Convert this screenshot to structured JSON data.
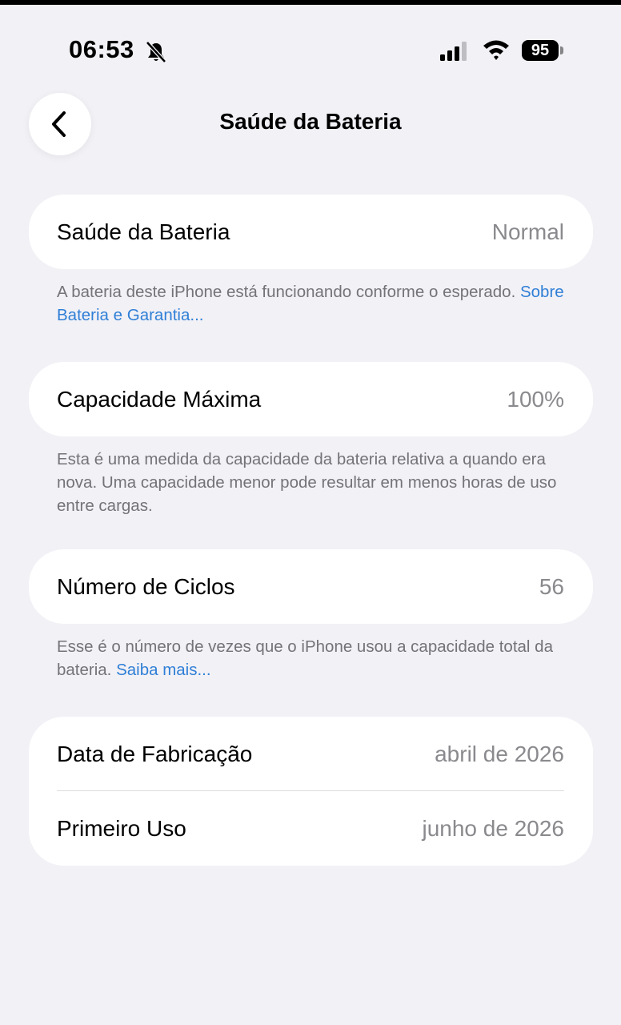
{
  "status_bar": {
    "time": "06:53",
    "battery_level": "95"
  },
  "nav": {
    "title": "Saúde da Bateria"
  },
  "sections": {
    "health": {
      "label": "Saúde da Bateria",
      "value": "Normal",
      "footnote_text": "A bateria deste iPhone está funcionando conforme o esperado. ",
      "footnote_link": "Sobre Bateria e Garantia..."
    },
    "capacity": {
      "label": "Capacidade Máxima",
      "value": "100%",
      "footnote_text": "Esta é uma medida da capacidade da bateria relativa a quando era nova. Uma capacidade menor pode resultar em menos horas de uso entre cargas."
    },
    "cycles": {
      "label": "Número de Ciclos",
      "value": "56",
      "footnote_text": "Esse é o número de vezes que o iPhone usou a capacidade total da bateria. ",
      "footnote_link": "Saiba mais..."
    },
    "dates": {
      "manufacture_label": "Data de Fabricação",
      "manufacture_value": "abril de 2026",
      "first_use_label": "Primeiro Uso",
      "first_use_value": "junho de 2026"
    }
  },
  "colors": {
    "background": "#f2f1f6",
    "card": "#ffffff",
    "secondary_text": "#8a8a8e",
    "link": "#2f7fd6"
  }
}
